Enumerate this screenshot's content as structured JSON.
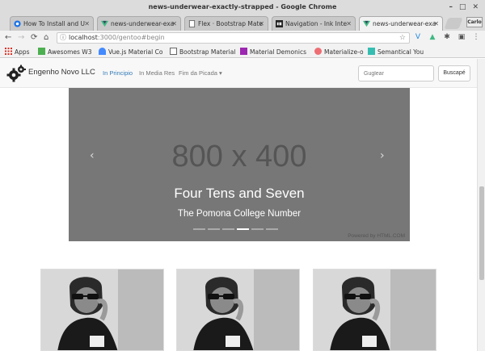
{
  "window": {
    "title": "news-underwear-exactly-strapped - Google Chrome"
  },
  "tabs": [
    {
      "label": "How To Install and U"
    },
    {
      "label": "news-underwear-exa"
    },
    {
      "label": "Flex · Bootstrap Mate"
    },
    {
      "label": "Navigation - Ink Inte"
    },
    {
      "label": "news-underwear-exa"
    }
  ],
  "profile": {
    "label": "Carlo"
  },
  "toolbar": {
    "url_host": "localhost",
    "url_path": ":3000/gentoo#begin"
  },
  "bookmarks": [
    {
      "label": "Apps"
    },
    {
      "label": "Awesomes W3"
    },
    {
      "label": "Vue.js Material Co"
    },
    {
      "label": "Bootstrap Material"
    },
    {
      "label": "Material Demonics"
    },
    {
      "label": "Materialize-o"
    },
    {
      "label": "Semantical You"
    }
  ],
  "navbar": {
    "brand": "Engenho Novo LLC",
    "links": [
      "In Principio",
      "In Media Res",
      "Fim da Picada ▾"
    ],
    "search_placeholder": "Guglear",
    "search_button": "Buscapé"
  },
  "carousel": {
    "placeholder": "800 x 400",
    "watermark": "Powered by HTML.COM",
    "caption_title": "Four Tens and Seven",
    "caption_sub": "The Pomona College Number",
    "prev_glyph": "‹",
    "next_glyph": "›",
    "indicator_count": 6,
    "active_index": 3
  }
}
